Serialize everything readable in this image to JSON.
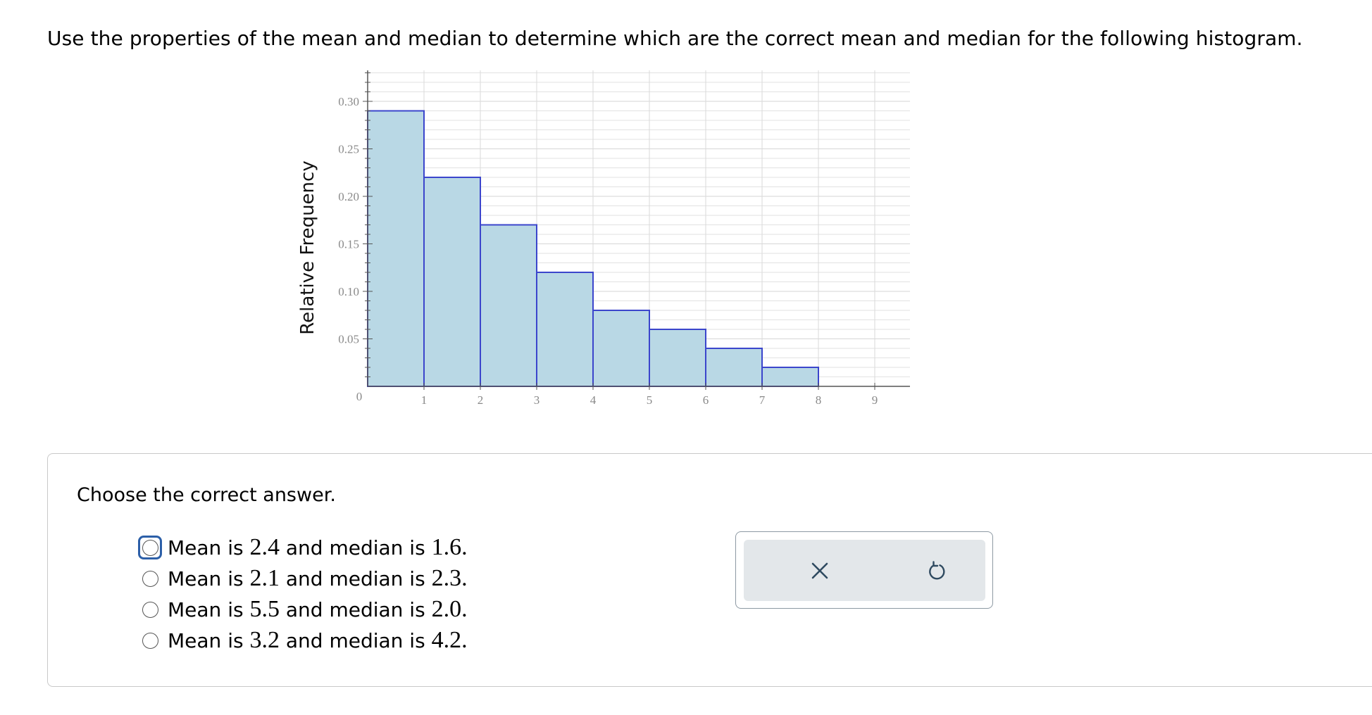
{
  "question": {
    "text": "Use the properties of the mean and median to determine which are the correct mean and median for the following histogram."
  },
  "chart_data": {
    "type": "bar",
    "histogram": true,
    "bin_edges": [
      0,
      1,
      2,
      3,
      4,
      5,
      6,
      7,
      8
    ],
    "values": [
      0.29,
      0.22,
      0.17,
      0.12,
      0.08,
      0.06,
      0.04,
      0.02
    ],
    "title": "",
    "xlabel": "",
    "ylabel": "Relative Frequency",
    "xlim": [
      0,
      9.5
    ],
    "ylim": [
      0,
      0.33
    ],
    "x_ticks": [
      "0",
      "1",
      "2",
      "3",
      "4",
      "5",
      "6",
      "7",
      "8",
      "9"
    ],
    "y_ticks": [
      "0.05",
      "0.10",
      "0.15",
      "0.20",
      "0.25",
      "0.30"
    ],
    "grid": true,
    "colors": {
      "bar_fill": "#b9d8e5",
      "bar_edge": "#3b45cc",
      "grid": "#e2e2e2",
      "axis": "#555555"
    }
  },
  "answer": {
    "prompt": "Choose the correct answer.",
    "options": [
      {
        "pre": "Mean is ",
        "mean": "2.4",
        "mid": " and median is ",
        "median": "1.6",
        "end": ".",
        "focused": true
      },
      {
        "pre": "Mean is ",
        "mean": "2.1",
        "mid": " and median is ",
        "median": "2.3",
        "end": ".",
        "focused": false
      },
      {
        "pre": "Mean is ",
        "mean": "5.5",
        "mid": " and median is ",
        "median": "2.0",
        "end": ".",
        "focused": false
      },
      {
        "pre": "Mean is ",
        "mean": "3.2",
        "mid": " and median is ",
        "median": "4.2",
        "end": ".",
        "focused": false
      }
    ]
  },
  "tools": {
    "clear_icon": "x-icon",
    "reset_icon": "undo-icon",
    "icon_color": "#2f4a60"
  }
}
